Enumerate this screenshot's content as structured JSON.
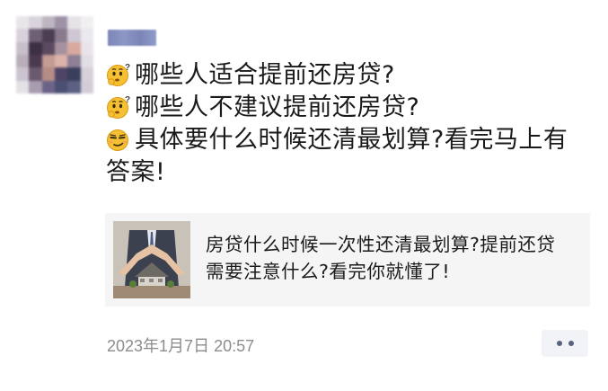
{
  "post": {
    "author_name": "",
    "lines": [
      {
        "emoji": "thinking-face-icon",
        "text": "哪些人适合提前还房贷?"
      },
      {
        "emoji": "thinking-face-icon",
        "text": "哪些人不建议提前还房贷?"
      },
      {
        "emoji": "smirk-face-icon",
        "text": "具体要什么时候还清最划算?看完马上有答案!"
      }
    ]
  },
  "link_card": {
    "title": "房贷什么时候一次性还清最划算?提前还贷需要注意什么?看完你就懂了!",
    "thumbnail": "house-protected-by-hands-image"
  },
  "footer": {
    "timestamp": "2023年1月7日 20:57",
    "more_button": "more-dots-icon"
  },
  "colors": {
    "text": "#1a1a1a",
    "timestamp": "#8c8c8c",
    "card_background": "#f5f5f5",
    "author_name_blur": "#8891c0",
    "more_dots": "#56627f"
  }
}
